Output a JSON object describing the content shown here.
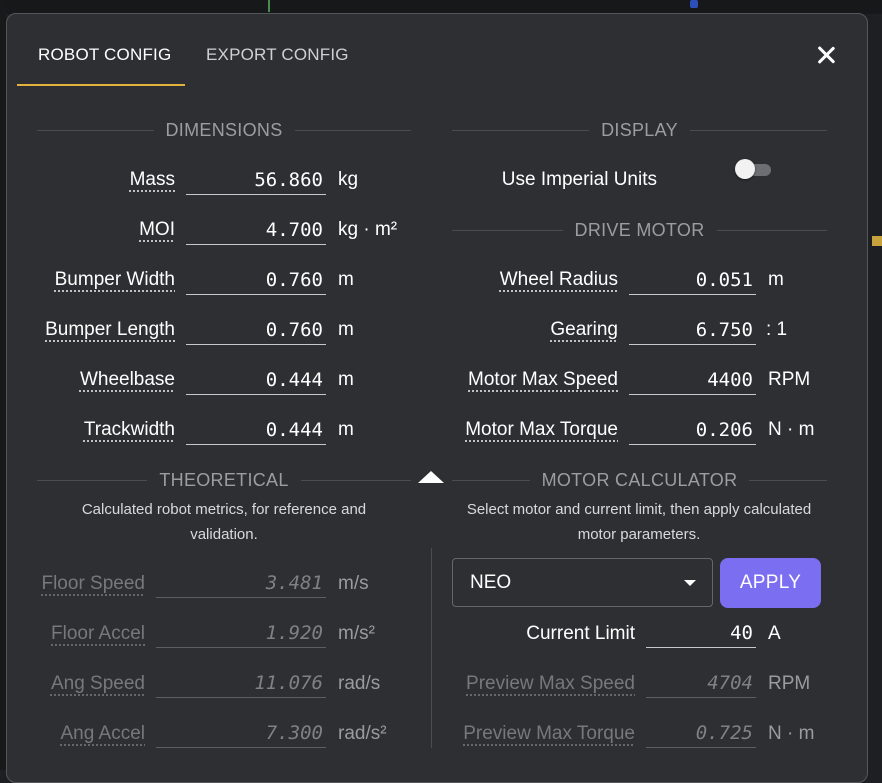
{
  "tabs": [
    {
      "label": "ROBOT CONFIG",
      "active": true
    },
    {
      "label": "EXPORT CONFIG",
      "active": false
    }
  ],
  "dimensions": {
    "heading": "DIMENSIONS",
    "rows": [
      {
        "label": "Mass",
        "value": "56.860",
        "unit": "kg"
      },
      {
        "label": "MOI",
        "value": "4.700",
        "unit": "kg · m²"
      },
      {
        "label": "Bumper Width",
        "value": "0.760",
        "unit": "m"
      },
      {
        "label": "Bumper Length",
        "value": "0.760",
        "unit": "m"
      },
      {
        "label": "Wheelbase",
        "value": "0.444",
        "unit": "m"
      },
      {
        "label": "Trackwidth",
        "value": "0.444",
        "unit": "m"
      }
    ]
  },
  "display": {
    "heading": "DISPLAY",
    "imperial_label": "Use Imperial Units",
    "imperial_on": false
  },
  "drive_motor": {
    "heading": "DRIVE MOTOR",
    "rows": [
      {
        "label": "Wheel Radius",
        "value": "0.051",
        "unit": "m"
      },
      {
        "label": "Gearing",
        "value": "6.750",
        "unit": ": 1"
      },
      {
        "label": "Motor Max Speed",
        "value": "4400",
        "unit": "RPM"
      },
      {
        "label": "Motor Max Torque",
        "value": "0.206",
        "unit": "N · m"
      }
    ]
  },
  "theoretical": {
    "heading": "THEORETICAL",
    "description": "Calculated robot metrics, for reference and validation.",
    "rows": [
      {
        "label": "Floor Speed",
        "value": "3.481",
        "unit": "m/s"
      },
      {
        "label": "Floor Accel",
        "value": "1.920",
        "unit": "m/s²"
      },
      {
        "label": "Ang Speed",
        "value": "11.076",
        "unit": "rad/s"
      },
      {
        "label": "Ang Accel",
        "value": "7.300",
        "unit": "rad/s²"
      }
    ]
  },
  "motor_calculator": {
    "heading": "MOTOR CALCULATOR",
    "description": "Select motor and current limit, then apply calculated motor parameters.",
    "motor_selected": "NEO",
    "apply_label": "APPLY",
    "current_limit_label": "Current Limit",
    "current_limit_value": "40",
    "current_limit_unit": "A",
    "preview_rows": [
      {
        "label": "Preview Max Speed",
        "value": "4704",
        "unit": "RPM"
      },
      {
        "label": "Preview Max Torque",
        "value": "0.725",
        "unit": "N · m"
      }
    ]
  },
  "colors": {
    "dialog_bg": "#2e2f33",
    "active_tab_indicator": "#e2b23c",
    "apply_button": "#7c6ef0"
  },
  "icons": {
    "close": "close-icon",
    "collapse": "collapse-arrow-icon",
    "dropdown": "chevron-down-icon"
  }
}
